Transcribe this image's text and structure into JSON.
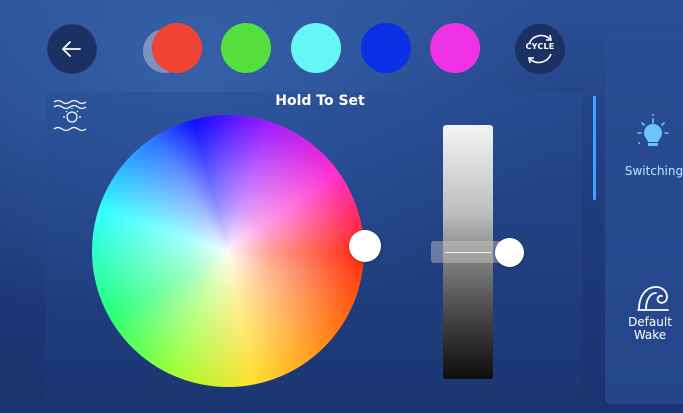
{
  "header": {
    "back_icon": "arrow-left-icon",
    "swatches": [
      {
        "color": "#ee4433",
        "selected": true
      },
      {
        "color": "#55e040"
      },
      {
        "color": "#66f6f6"
      },
      {
        "color": "#0a2fe6"
      },
      {
        "color": "#ee33e6"
      }
    ],
    "cycle_label": "CYCLE"
  },
  "main": {
    "title": "Hold To Set",
    "mode_icon": "sunrise-lamp-icon",
    "brightness_level": 0.5
  },
  "side": {
    "items": [
      {
        "label": "Switching",
        "icon": "bulb-icon",
        "active": true
      },
      {
        "label": "Default Wake",
        "icon": "wave-icon",
        "active": false
      }
    ]
  },
  "colors": {
    "background": "#1f3c7e",
    "accent": "#3fa0ff"
  }
}
